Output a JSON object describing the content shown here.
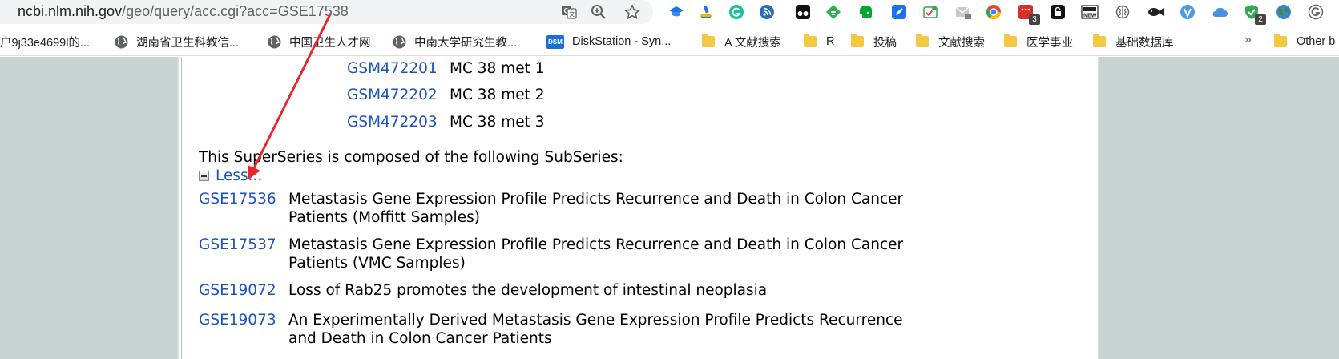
{
  "browser": {
    "url_host": "ncbi.nlm.nih.gov",
    "url_path": "/geo/query/acc.cgi?acc=GSE17538",
    "omnibox_icons": [
      "translate-icon",
      "zoom-icon",
      "star-icon"
    ],
    "extension_icons": [
      {
        "name": "graduation-cap-icon",
        "color": "#1a73e8",
        "badge": ""
      },
      {
        "name": "microscope-icon",
        "color": "#3b6fd8",
        "badge": ""
      },
      {
        "name": "grammarly-icon",
        "color": "#15c39a",
        "badge": ""
      },
      {
        "name": "rss-reader-icon",
        "color": "#2a6ebb",
        "badge": ""
      },
      {
        "name": "tampermonkey-icon",
        "color": "#111111",
        "badge": ""
      },
      {
        "name": "feedly-icon",
        "color": "#2bb24c",
        "badge": ""
      },
      {
        "name": "evernote-icon",
        "color": "#00a82d",
        "badge": ""
      },
      {
        "name": "pen-icon",
        "color": "#1a73e8",
        "badge": ""
      },
      {
        "name": "checklist-icon",
        "color": "#34a853",
        "badge": ""
      },
      {
        "name": "mail-icon",
        "color": "#9aa0a6",
        "badge": ""
      },
      {
        "name": "chrome-icon",
        "color": "#ea4335",
        "badge": ""
      },
      {
        "name": "apps-icon",
        "color": "#d93025",
        "badge": "3"
      },
      {
        "name": "lock-icon",
        "color": "#111111",
        "badge": ""
      },
      {
        "name": "new-icon",
        "color": "#202124",
        "badge": ""
      },
      {
        "name": "brain-icon",
        "color": "#5f6368",
        "badge": ""
      },
      {
        "name": "fish-icon",
        "color": "#202124",
        "badge": ""
      },
      {
        "name": "v-icon",
        "color": "#4a9be8",
        "badge": ""
      },
      {
        "name": "cloud-icon",
        "color": "#4a90e2",
        "badge": ""
      },
      {
        "name": "shield-check-icon",
        "color": "#34a853",
        "badge": "2"
      },
      {
        "name": "globe-icon",
        "color": "#3c8d2f",
        "badge": ""
      },
      {
        "name": "google-icon",
        "color": "#5f6368",
        "badge": ""
      }
    ]
  },
  "bookmarks": [
    {
      "label": "户9j33e4699l的...",
      "icon": "none"
    },
    {
      "label": "湖南省卫生科教信...",
      "icon": "globe"
    },
    {
      "label": "中国卫生人才网",
      "icon": "globe"
    },
    {
      "label": "中南大学研究生教...",
      "icon": "globe"
    },
    {
      "label": "DiskStation - Syn...",
      "icon": "dsm"
    },
    {
      "label": "A 文献搜索",
      "icon": "folder"
    },
    {
      "label": "R",
      "icon": "folder"
    },
    {
      "label": "投稿",
      "icon": "folder"
    },
    {
      "label": "文献搜索",
      "icon": "folder"
    },
    {
      "label": "医学事业",
      "icon": "folder"
    },
    {
      "label": "基础数据库",
      "icon": "folder"
    },
    {
      "label": "Other b",
      "icon": "folder"
    }
  ],
  "bookmarks_more": "»",
  "dsm_logo_text": "DSM",
  "samples": [
    {
      "id": "GSM472201",
      "label": "MC 38 met 1"
    },
    {
      "id": "GSM472202",
      "label": "MC 38 met 2"
    },
    {
      "id": "GSM472203",
      "label": "MC 38 met 3"
    }
  ],
  "superseries_intro": "This SuperSeries is composed of the following SubSeries:",
  "less_label": "Less...",
  "subseries": [
    {
      "id": "GSE17536",
      "title": "Metastasis Gene Expression Profile Predicts Recurrence and Death in Colon Cancer Patients (Moffitt Samples)"
    },
    {
      "id": "GSE17537",
      "title": "Metastasis Gene Expression Profile Predicts Recurrence and Death in Colon Cancer Patients (VMC Samples)"
    },
    {
      "id": "GSE19072",
      "title": "Loss of Rab25 promotes the development of intestinal neoplasia"
    },
    {
      "id": "GSE19073",
      "title": "An Experimentally Derived Metastasis Gene Expression Profile Predicts Recurrence and Death in Colon Cancer Patients"
    }
  ],
  "annotation_arrow_color": "#e8262b"
}
